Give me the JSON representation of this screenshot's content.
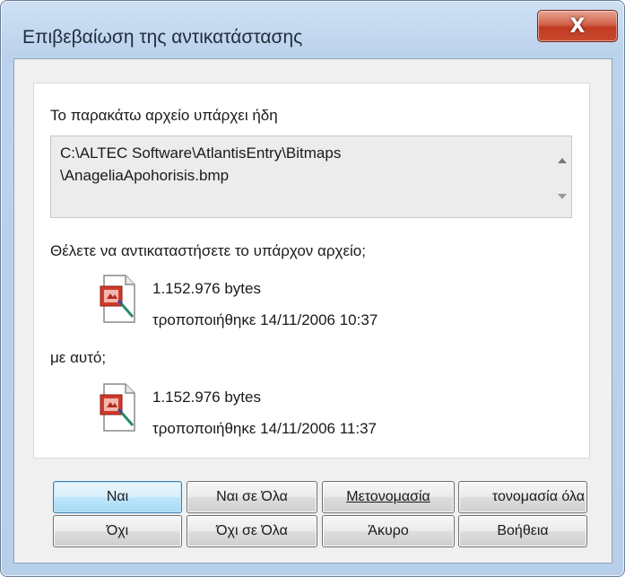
{
  "window": {
    "title": "Επιβεβαίωση της αντικατάστασης",
    "close_label": "X"
  },
  "existing": {
    "heading": "Το παρακάτω αρχείο υπάρχει ήδη",
    "path_line1": "C:\\ALTEC Software\\AtlantisEntry\\Bitmaps",
    "path_line2": "\\AnageliaApohorisis.bmp"
  },
  "question": "Θέλετε να αντικαταστήσετε το υπάρχον αρχείο;",
  "file_old": {
    "size": "1.152.976 bytes",
    "modified": "τροποποιήθηκε 14/11/2006 10:37",
    "icon": "bitmap-file-icon"
  },
  "with_this": "με αυτό;",
  "file_new": {
    "size": "1.152.976 bytes",
    "modified": "τροποποιήθηκε 14/11/2006 11:37",
    "icon": "bitmap-file-icon"
  },
  "buttons": {
    "yes": "Ναι",
    "yes_all": "Ναι σε Όλα",
    "rename": "Μετονομασία",
    "rename_all": "τονομασία όλα",
    "no": "Όχι",
    "no_all": "Όχι σε Όλα",
    "cancel": "Άκυρο",
    "help": "Βοήθεια"
  },
  "colors": {
    "close_button": "#c84a2e",
    "default_button_border": "#3c7fb1"
  }
}
